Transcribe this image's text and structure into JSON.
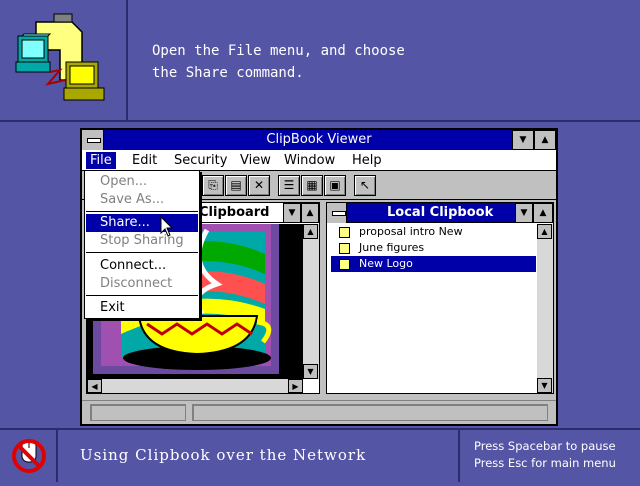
{
  "instruction": {
    "line1": "Open the File menu, and choose",
    "line2": "the Share command."
  },
  "footer": {
    "caption": "Using Clipbook over the Network",
    "hint1": "Press Spacebar to pause",
    "hint2": "Press Esc for main menu"
  },
  "window": {
    "title": "ClipBook Viewer"
  },
  "menu": {
    "file": "File",
    "edit": "Edit",
    "security": "Security",
    "view": "View",
    "window": "Window",
    "help": "Help"
  },
  "file_menu": {
    "open": "Open...",
    "save_as": "Save As...",
    "share": "Share...",
    "stop_sharing": "Stop Sharing",
    "connect": "Connect...",
    "disconnect": "Disconnect",
    "exit": "Exit"
  },
  "clipboard_pane": {
    "title": "Clipboard"
  },
  "local_pane": {
    "title": "Local Clipbook",
    "items": [
      "proposal intro New",
      "June figures",
      "New Logo"
    ],
    "selected_index": 2
  },
  "colors": {
    "background": "#5555a6",
    "title_bar": "#0000a8",
    "window_face": "#c0c0c0"
  }
}
